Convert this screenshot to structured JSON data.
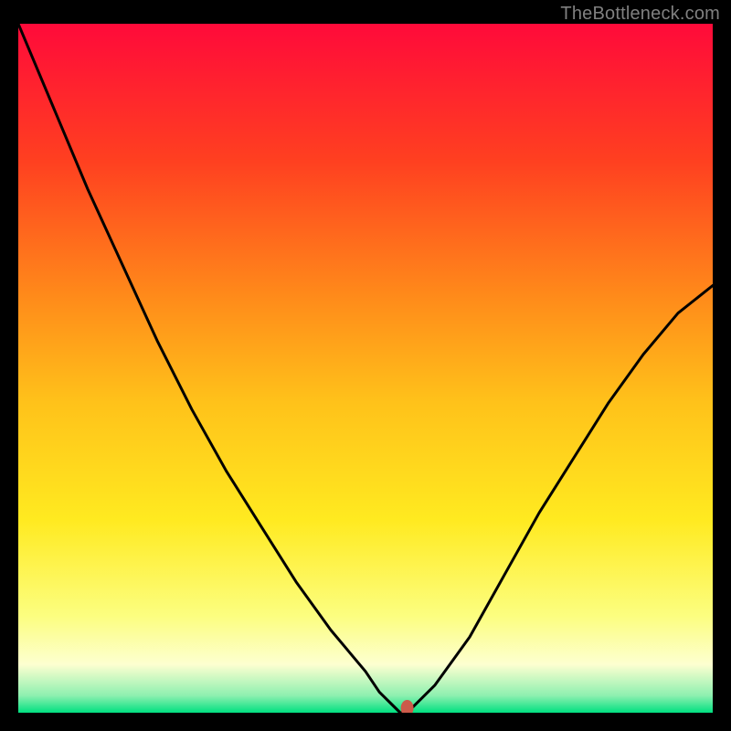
{
  "watermark": "TheBottleneck.com",
  "chart_data": {
    "type": "line",
    "title": "",
    "xlabel": "",
    "ylabel": "",
    "xlim": [
      0,
      100
    ],
    "ylim": [
      0,
      100
    ],
    "grid": false,
    "legend": false,
    "background_gradient": {
      "stops": [
        {
          "pos": 0.0,
          "color": "#ff0a3a"
        },
        {
          "pos": 0.2,
          "color": "#ff4020"
        },
        {
          "pos": 0.4,
          "color": "#ff8c1a"
        },
        {
          "pos": 0.55,
          "color": "#ffc21a"
        },
        {
          "pos": 0.72,
          "color": "#ffea20"
        },
        {
          "pos": 0.86,
          "color": "#fcfe80"
        },
        {
          "pos": 0.93,
          "color": "#fdffd0"
        },
        {
          "pos": 0.975,
          "color": "#8ef0b0"
        },
        {
          "pos": 1.0,
          "color": "#00e080"
        }
      ]
    },
    "series": [
      {
        "name": "bottleneck-curve",
        "x": [
          0,
          5,
          10,
          15,
          20,
          25,
          30,
          35,
          40,
          45,
          50,
          52,
          54,
          55,
          56,
          60,
          65,
          70,
          75,
          80,
          85,
          90,
          95,
          100
        ],
        "values": [
          100,
          88,
          76,
          65,
          54,
          44,
          35,
          27,
          19,
          12,
          6,
          3,
          1,
          0,
          0,
          4,
          11,
          20,
          29,
          37,
          45,
          52,
          58,
          62
        ]
      }
    ],
    "marker": {
      "x": 56,
      "y": 0,
      "color": "#cc5a4a"
    }
  }
}
